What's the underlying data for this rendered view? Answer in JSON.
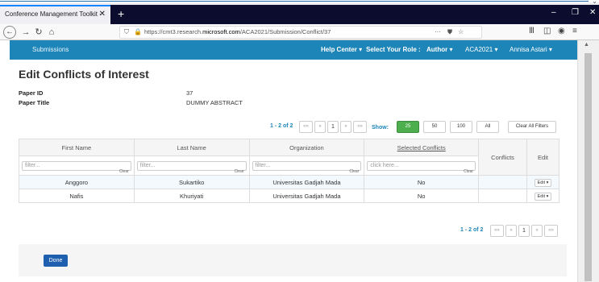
{
  "browser": {
    "tab_title": "Conference Management Toolkit - ",
    "tab_close": "✕",
    "new_tab": "+",
    "url_prefix": "https://cmt3.research.",
    "url_host": "microsoft.com",
    "url_path": "/ACA2021/Submission/Conflict/37",
    "url_more": "···",
    "window_min": "–",
    "window_max": "❐",
    "window_close": "✕"
  },
  "appbar": {
    "submissions": "Submissions",
    "help_center": "Help Center",
    "select_role": "Select Your Role :",
    "role": "Author",
    "conference": "ACA2021",
    "user": "Annisa Astari"
  },
  "page": {
    "title": "Edit Conflicts of Interest",
    "paper_id_label": "Paper ID",
    "paper_id": "37",
    "paper_title_label": "Paper Title",
    "paper_title": "DUMMY ABSTRACT"
  },
  "pager": {
    "count": "1 - 2 of 2",
    "first": "««",
    "prev": "«",
    "page": "1",
    "next": "»",
    "last": "»»"
  },
  "show": {
    "label": "Show:",
    "options": [
      "25",
      "50",
      "100",
      "All"
    ],
    "selected": "25",
    "clear_all": "Clear All Filters"
  },
  "table": {
    "headers": [
      "First Name",
      "Last Name",
      "Organization",
      "Selected Conflicts",
      "Conflicts",
      "Edit"
    ],
    "filter_placeholders": [
      "filter...",
      "filter...",
      "filter...",
      "click here..."
    ],
    "clear": "Clear",
    "rows": [
      {
        "first": "Anggoro",
        "last": "Sukartiko",
        "org": "Universitas Gadjah Mada",
        "selected": "No",
        "conflicts": "",
        "edit": "Edit ▾"
      },
      {
        "first": "Nafis",
        "last": "Khuriyati",
        "org": "Universitas Gadjah Mada",
        "selected": "No",
        "conflicts": "",
        "edit": "Edit ▾"
      }
    ]
  },
  "footer": {
    "done": "Done"
  }
}
